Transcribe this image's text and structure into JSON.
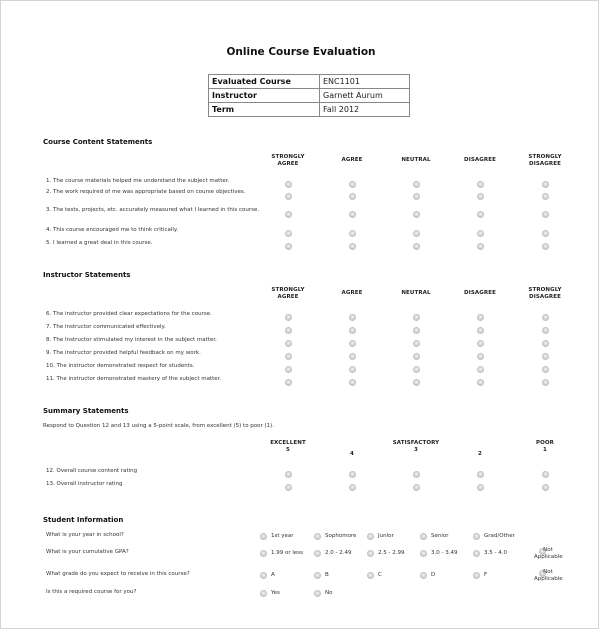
{
  "title": "Online Course Evaluation",
  "info_table": [
    {
      "label": "Evaluated Course",
      "value": "ENC1101"
    },
    {
      "label": "Instructor",
      "value": "Garnett Aurum"
    },
    {
      "label": "Term",
      "value": "Fall 2012"
    }
  ],
  "likert_columns": [
    "STRONGLY AGREE",
    "AGREE",
    "NEUTRAL",
    "DISAGREE",
    "STRONGLY DISAGREE"
  ],
  "course_content": {
    "heading": "Course Content Statements",
    "statements": [
      "1. The course materials helped me understand the subject matter.",
      "2. The work required of me was appropriate based on course objectives.",
      "3. The tests, projects, etc. accurately measured what I learned in this course.",
      "4. This course encouraged me to think critically.",
      "5. I learned a great deal in this course."
    ]
  },
  "instructor": {
    "heading": "Instructor Statements",
    "statements": [
      "6. The instructor provided clear expectations for the course.",
      "7. The instructor communicated effectively.",
      "8. The Instructor stimulated my interest in the subject matter.",
      "9. The instructor provided helpful feedback on my work.",
      "10. The instructor demonstrated respect for students.",
      "11. The instructor demonstrated mastery of the subject matter."
    ]
  },
  "summary": {
    "heading": "Summary Statements",
    "note": "Respond to Question 12 and 13 using a 5-point scale, from excellent (5) to poor (1).",
    "columns": [
      {
        "label": "EXCELLENT",
        "value": "5"
      },
      {
        "label": "",
        "value": "4"
      },
      {
        "label": "SATISFACTORY",
        "value": "3"
      },
      {
        "label": "",
        "value": "2"
      },
      {
        "label": "POOR",
        "value": "1"
      }
    ],
    "statements": [
      "12. Overall course content rating",
      "13. Overall instructor rating"
    ]
  },
  "student_info": {
    "heading": "Student Information",
    "questions": [
      {
        "question": "What is your year in school?",
        "options": [
          "1st year",
          "Sophomore",
          "Junior",
          "Senior",
          "Grad/Other"
        ]
      },
      {
        "question": "What is your cumulative GPA?",
        "options": [
          "1.99 or less",
          "2.0 - 2.49",
          "2.5 - 2.99",
          "3.0 - 3.49",
          "3.5 - 4.0"
        ],
        "na_label": "Not Applicable"
      },
      {
        "question": "What grade do you expect to receive in this course?",
        "options": [
          "A",
          "B",
          "C",
          "D",
          "F"
        ],
        "na_label": "Not Applicable"
      },
      {
        "question": "Is this a required course for you?",
        "options": [
          "Yes",
          "No"
        ]
      }
    ]
  }
}
